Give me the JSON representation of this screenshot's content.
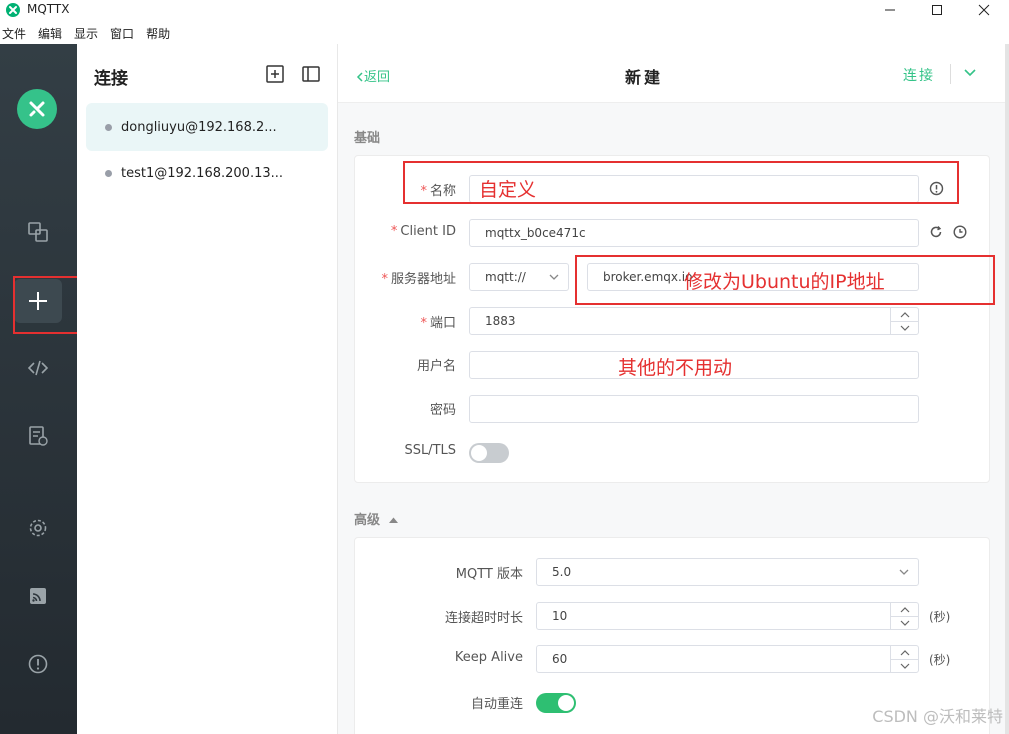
{
  "window": {
    "title": "MQTTX"
  },
  "menu": [
    "文件",
    "编辑",
    "显示",
    "窗口",
    "帮助"
  ],
  "connections": {
    "title": "连接",
    "items": [
      {
        "name": "dongliuyu@192.168.2..."
      },
      {
        "name": "test1@192.168.200.13..."
      }
    ]
  },
  "header": {
    "back": "返回",
    "title": "新建",
    "connect": "连接"
  },
  "basic": {
    "section": "基础",
    "name_label": "名称",
    "client_id_label": "Client ID",
    "client_id_value": "mqttx_b0ce471c",
    "host_label": "服务器地址",
    "protocol_value": "mqtt://",
    "host_value": "broker.emqx.io",
    "port_label": "端口",
    "port_value": "1883",
    "username_label": "用户名",
    "password_label": "密码",
    "ssl_label": "SSL/TLS"
  },
  "advanced": {
    "section": "高级",
    "mqtt_version_label": "MQTT 版本",
    "mqtt_version_value": "5.0",
    "timeout_label": "连接超时时长",
    "timeout_value": "10",
    "timeout_unit": "(秒)",
    "keepalive_label": "Keep Alive",
    "keepalive_value": "60",
    "keepalive_unit": "(秒)",
    "reconnect_label": "自动重连"
  },
  "annotations": {
    "name_hint": "自定义",
    "host_hint": "修改为Ubuntu的IP地址",
    "other_hint": "其他的不用动"
  },
  "watermark": "CSDN @沃和莱特",
  "colors": {
    "accent": "#34c388",
    "annotation": "#e53030",
    "sidebar": "#2d363c"
  }
}
